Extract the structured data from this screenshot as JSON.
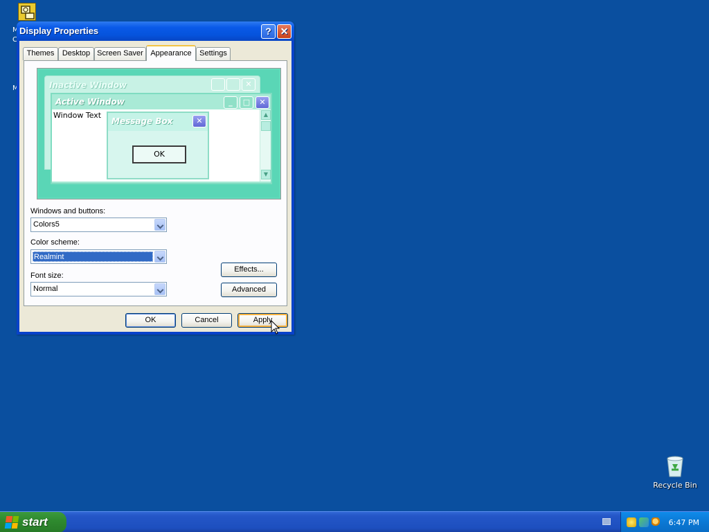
{
  "desktop": {
    "clipped_label_1": "M",
    "clipped_label_2": "C",
    "clipped_label_3": "M",
    "recycle_bin_label": "Recycle Bin"
  },
  "dialog": {
    "title": "Display Properties",
    "help_glyph": "?",
    "close_glyph": "✕",
    "tabs": [
      {
        "label": "Themes"
      },
      {
        "label": "Desktop"
      },
      {
        "label": "Screen Saver"
      },
      {
        "label": "Appearance",
        "active": true
      },
      {
        "label": "Settings"
      }
    ],
    "preview": {
      "inactive_title": "Inactive Window",
      "active_title": "Active Window",
      "window_text": "Window Text",
      "message_title": "Message Box",
      "message_ok": "OK"
    },
    "windows_buttons": {
      "label": "Windows and buttons:",
      "value": "Colors5"
    },
    "color_scheme": {
      "label": "Color scheme:",
      "value": "Realmint"
    },
    "font_size": {
      "label": "Font size:",
      "value": "Normal"
    },
    "effects_label": "Effects...",
    "advanced_label": "Advanced",
    "ok_label": "OK",
    "cancel_label": "Cancel",
    "apply_label": "Apply"
  },
  "taskbar": {
    "start_label": "start",
    "clock": "6:47 PM"
  },
  "colors": {
    "desktop": "#0a4f9f",
    "titlebar": "#0553dc",
    "dialog_face": "#ece9d8",
    "preview_bg": "#5ad6b6",
    "start_green": "#2f8a2f",
    "tray_blue": "#0b78d4"
  },
  "icons": [
    "display-properties-icon",
    "recycle-bin-icon",
    "windows-flag-icon",
    "keyboard-icon",
    "security-shield-icon",
    "network-icon",
    "search-icon",
    "mouse-cursor-icon"
  ]
}
